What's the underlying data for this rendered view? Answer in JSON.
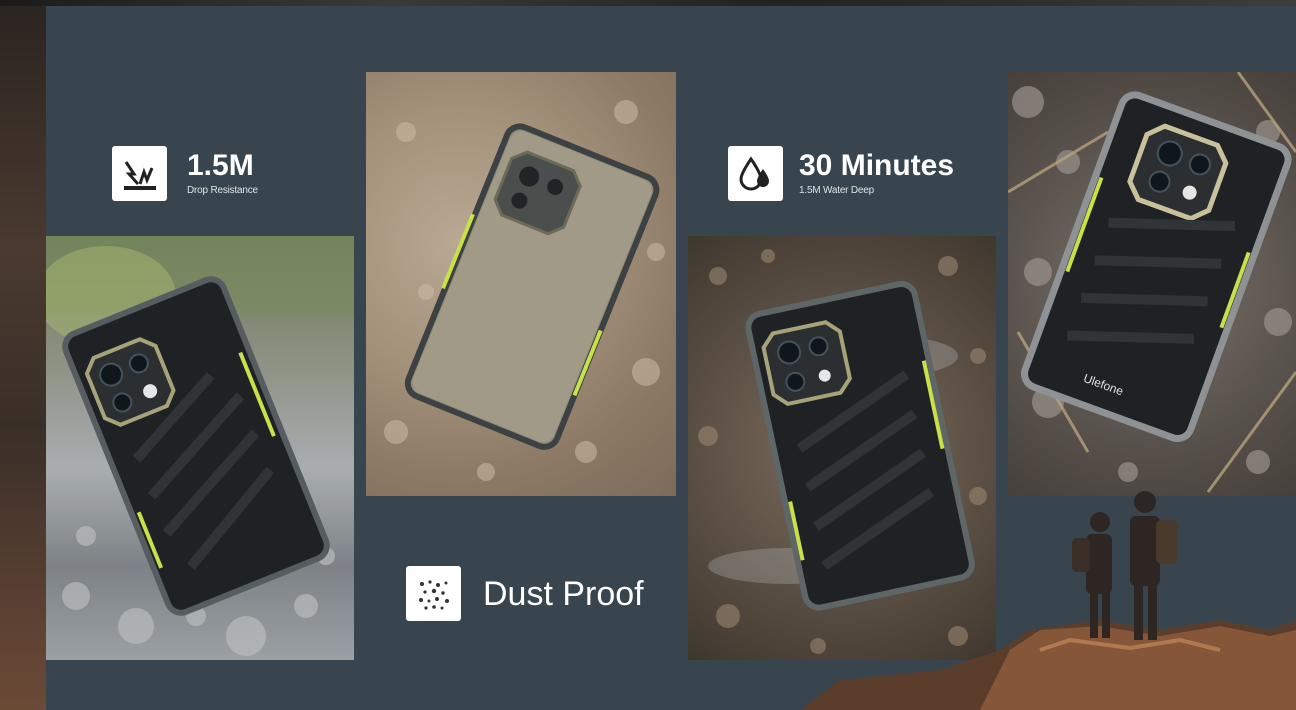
{
  "features": {
    "drop": {
      "title": "1.5M",
      "subtitle": "Drop Resistance",
      "icon": "drop-impact-icon"
    },
    "water": {
      "title": "30 Minutes",
      "subtitle": "1.5M Water Deep",
      "icon": "water-drop-icon"
    },
    "dust": {
      "title": "Dust Proof",
      "icon": "dust-icon"
    }
  },
  "phone_brand_text": "Ulefone",
  "colors": {
    "panel": "#38454e",
    "accent_yellow": "#c8e04a",
    "phone_body": "#1e2225"
  }
}
